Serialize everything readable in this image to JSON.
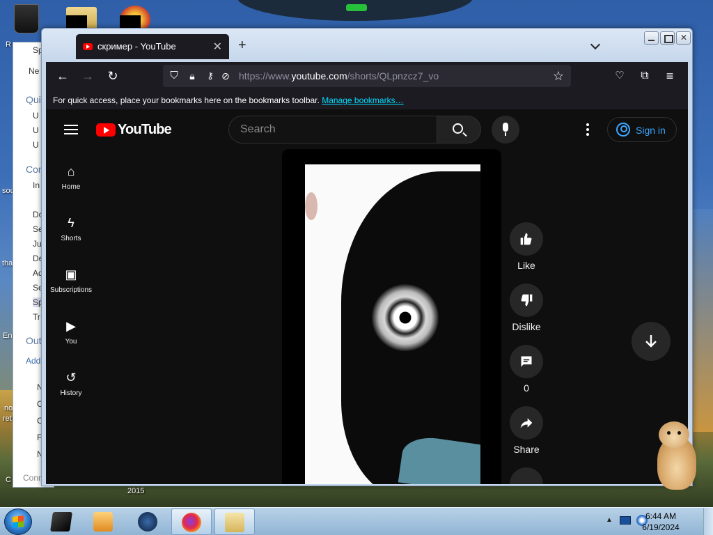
{
  "desktop": {
    "icon_label_year": "2015",
    "side_labels": [
      "R",
      "sou",
      "tha",
      "En",
      "no",
      "ret",
      "C"
    ]
  },
  "back_window": {
    "items": [
      {
        "text": "Sp",
        "kind": "item"
      },
      {
        "text": "Ne",
        "kind": "item"
      },
      {
        "text": "Qui",
        "kind": "head"
      },
      {
        "text": "U",
        "kind": "item"
      },
      {
        "text": "U",
        "kind": "item"
      },
      {
        "text": "U",
        "kind": "item"
      },
      {
        "text": "Con",
        "kind": "head"
      },
      {
        "text": "In",
        "kind": "item"
      },
      {
        "text": "Do",
        "kind": "item"
      },
      {
        "text": "Se",
        "kind": "item"
      },
      {
        "text": "Ju",
        "kind": "item"
      },
      {
        "text": "De",
        "kind": "item"
      },
      {
        "text": "Ad",
        "kind": "item"
      },
      {
        "text": "Se",
        "kind": "item"
      },
      {
        "text": "Sp",
        "kind": "item"
      },
      {
        "text": "Tr",
        "kind": "item"
      },
      {
        "text": "Out",
        "kind": "head"
      },
      {
        "text": "Add",
        "kind": "item"
      },
      {
        "text": "N",
        "kind": "item"
      },
      {
        "text": "C",
        "kind": "item"
      },
      {
        "text": "C",
        "kind": "item"
      },
      {
        "text": "F",
        "kind": "item"
      },
      {
        "text": "N",
        "kind": "item"
      },
      {
        "text": "Conn",
        "kind": "item"
      }
    ]
  },
  "browser": {
    "tab": {
      "title": "скример - YouTube"
    },
    "url": {
      "prefix": "https://www.",
      "host": "youtube.com",
      "path": "/shorts/QLpnzcz7_vo"
    },
    "bookmarks_bar": {
      "message": "For quick access, place your bookmarks here on the bookmarks toolbar.",
      "link": "Manage bookmarks…"
    }
  },
  "youtube": {
    "logo_text": "YouTube",
    "search_placeholder": "Search",
    "sign_in": "Sign in",
    "guide": [
      {
        "label": "Home",
        "icon": "home-icon"
      },
      {
        "label": "Shorts",
        "icon": "shorts-icon"
      },
      {
        "label": "Subscriptions",
        "icon": "subscriptions-icon"
      },
      {
        "label": "You",
        "icon": "you-icon"
      },
      {
        "label": "History",
        "icon": "history-icon"
      }
    ],
    "actions": {
      "like": "Like",
      "dislike": "Dislike",
      "comments": "0",
      "share": "Share"
    }
  },
  "taskbar": {
    "time": "6:44 AM",
    "date": "6/19/2024"
  },
  "colors": {
    "yt_red": "#ff0000",
    "yt_bg": "#0f0f0f",
    "link_blue": "#3ea6ff",
    "firefox_toolbar": "#1c1b22"
  }
}
